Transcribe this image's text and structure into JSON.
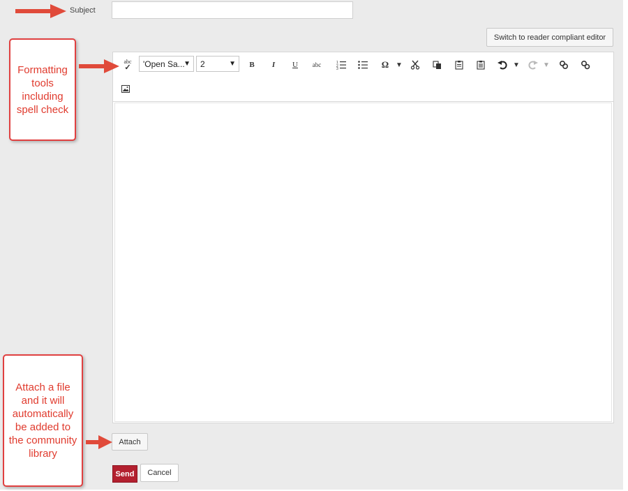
{
  "form": {
    "subject_label": "Subject",
    "subject_value": "",
    "switch_editor_label": "Switch to reader compliant editor",
    "attach_label": "Attach",
    "send_label": "Send",
    "cancel_label": "Cancel"
  },
  "toolbar": {
    "font_family": "'Open Sa...",
    "font_size": "2",
    "bold": "B",
    "italic": "I",
    "underline": "U",
    "strikethrough": "abc",
    "special_char": "Ω",
    "spellcheck": "abc",
    "icons": [
      "spellcheck-icon",
      "bold-icon",
      "italic-icon",
      "underline-icon",
      "strikethrough-icon",
      "ordered-list-icon",
      "unordered-list-icon",
      "special-character-icon",
      "cut-icon",
      "copy-icon",
      "paste-icon",
      "paste-text-icon",
      "undo-icon",
      "redo-icon",
      "link-icon",
      "unlink-icon",
      "image-icon"
    ]
  },
  "callouts": {
    "formatting": "Formatting tools including spell check",
    "attach": "Attach a file and it will automatically be added to the community library"
  },
  "colors": {
    "send_button": "#b3202f",
    "callout_border": "#e04040",
    "callout_text": "#e03b2e",
    "arrow": "#e04a3a",
    "background": "#ebebeb"
  }
}
